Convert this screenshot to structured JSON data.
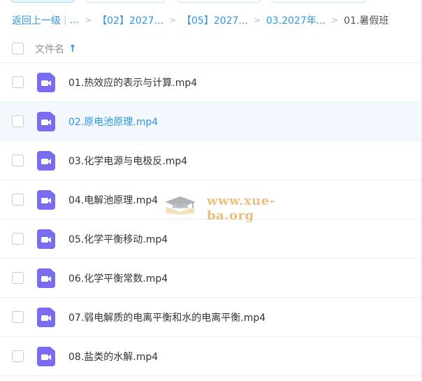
{
  "breadcrumb": {
    "back": "返回上一级",
    "ellipsis": "...",
    "items": [
      "【02】2027...",
      "【05】2027...",
      "03.2027年..."
    ],
    "current": "01.暑假班"
  },
  "header": {
    "column_label": "文件名",
    "sort_glyph": "↑"
  },
  "files": [
    {
      "name": "01.热效应的表示与计算.mp4"
    },
    {
      "name": "02.原电池原理.mp4"
    },
    {
      "name": "03.化学电源与电极反.mp4"
    },
    {
      "name": "04.电解池原理.mp4"
    },
    {
      "name": "05.化学平衡移动.mp4"
    },
    {
      "name": "06.化学平衡常数.mp4"
    },
    {
      "name": "07.弱电解质的电离平衡和水的电离平衡.mp4"
    },
    {
      "name": "08.盐类的水解.mp4"
    }
  ],
  "watermark": {
    "text": "www.xue-ba.org"
  },
  "colors": {
    "accent": "#2d97e6",
    "video_icon": "#7a6cf0",
    "highlight_row": "#f2f8fe",
    "watermark": "#e8b56a"
  },
  "icons": {
    "file_type": "video-file-icon",
    "sort": "sort-ascending-icon"
  }
}
